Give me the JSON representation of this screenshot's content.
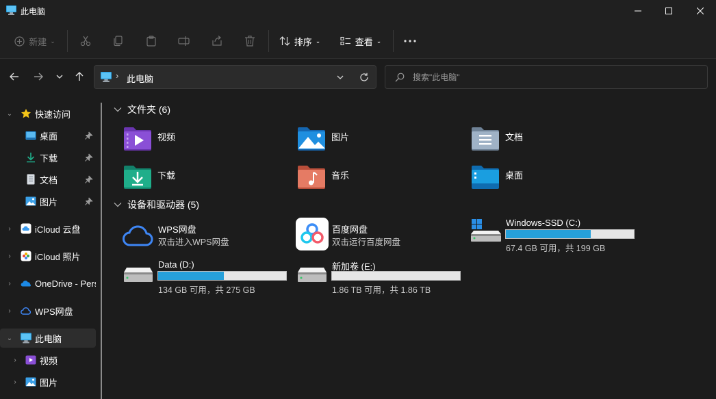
{
  "window": {
    "title": "此电脑"
  },
  "toolbar": {
    "new_label": "新建",
    "sort_label": "排序",
    "view_label": "查看"
  },
  "address": {
    "location": "此电脑"
  },
  "search": {
    "placeholder": "搜索\"此电脑\""
  },
  "sidebar": {
    "items": [
      {
        "label": "快速访问",
        "icon": "star-icon"
      },
      {
        "label": "桌面",
        "icon": "desktop-icon",
        "pinned": true
      },
      {
        "label": "下载",
        "icon": "download-icon",
        "pinned": true
      },
      {
        "label": "文档",
        "icon": "document-icon",
        "pinned": true
      },
      {
        "label": "图片",
        "icon": "picture-icon",
        "pinned": true
      },
      {
        "label": "iCloud 云盘",
        "icon": "icloud-drive-icon"
      },
      {
        "label": "iCloud 照片",
        "icon": "icloud-photos-icon"
      },
      {
        "label": "OneDrive - Pers",
        "icon": "onedrive-icon"
      },
      {
        "label": "WPS网盘",
        "icon": "wps-cloud-icon"
      },
      {
        "label": "此电脑",
        "icon": "this-pc-icon",
        "selected": true
      },
      {
        "label": "视频",
        "icon": "video-icon"
      },
      {
        "label": "图片",
        "icon": "picture-icon"
      }
    ]
  },
  "main": {
    "folders_header": "文件夹 (6)",
    "folders": [
      {
        "label": "视频",
        "icon": "videos-folder-icon",
        "color": "#8a4fd6"
      },
      {
        "label": "图片",
        "icon": "pictures-folder-icon",
        "color": "#1f8fe0"
      },
      {
        "label": "文档",
        "icon": "documents-folder-icon",
        "color": "#8fa3b8"
      },
      {
        "label": "下载",
        "icon": "downloads-folder-icon",
        "color": "#1fae8a"
      },
      {
        "label": "音乐",
        "icon": "music-folder-icon",
        "color": "#e0705a"
      },
      {
        "label": "桌面",
        "icon": "desktop-folder-icon",
        "color": "#1a9ee0"
      }
    ],
    "devices_header": "设备和驱动器 (5)",
    "devices": [
      {
        "name": "WPS网盘",
        "sub": "双击进入WPS网盘",
        "icon": "wps-cloud-icon"
      },
      {
        "name": "百度网盘",
        "sub": "双击运行百度网盘",
        "icon": "baidu-netdisk-icon"
      },
      {
        "name": "Windows-SSD (C:)",
        "sub": "67.4 GB 可用，共 199 GB",
        "icon": "windows-drive-icon",
        "used_fraction": 0.661
      },
      {
        "name": "Data (D:)",
        "sub": "134 GB 可用，共 275 GB",
        "icon": "hard-drive-icon",
        "used_fraction": 0.513
      },
      {
        "name": "新加卷 (E:)",
        "sub": "1.86 TB 可用，共 1.86 TB",
        "icon": "hard-drive-icon",
        "used_fraction": 0.0
      }
    ]
  },
  "colors": {
    "accent": "#26a0da",
    "background": "#1c1c1c",
    "toolbar": "#202020"
  }
}
